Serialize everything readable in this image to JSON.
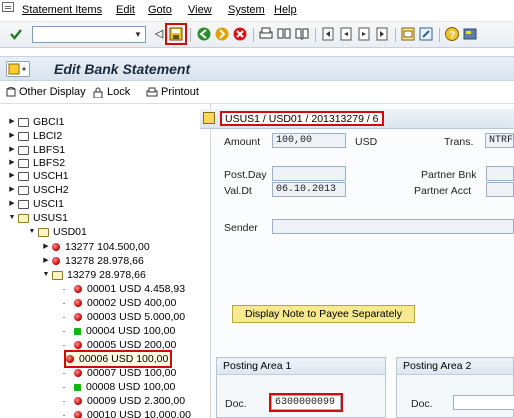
{
  "menubar": {
    "items": [
      "Statement Items",
      "Edit",
      "Goto",
      "View",
      "System",
      "Help"
    ]
  },
  "toolbar": {
    "command_field_value": "",
    "icons": [
      "check-icon",
      "back-icon",
      "save-icon",
      "nav-back-icon",
      "exit-icon",
      "cancel-icon",
      "print-icon",
      "find-icon",
      "find-next-icon",
      "first-page-icon",
      "prev-page-icon",
      "next-page-icon",
      "last-page-icon",
      "new-session-icon",
      "shortcut-icon",
      "help-icon",
      "customize-icon"
    ]
  },
  "title": "Edit Bank Statement",
  "app_toolbar": {
    "other_display": "Other Display",
    "lock": "Lock",
    "printout": "Printout"
  },
  "tree": {
    "nodes": [
      {
        "label": "GBCI1"
      },
      {
        "label": "LBCI2"
      },
      {
        "label": "LBFS1"
      },
      {
        "label": "LBFS2"
      },
      {
        "label": "USCH1"
      },
      {
        "label": "USCH2"
      },
      {
        "label": "USCI1"
      },
      {
        "label": "USUS1"
      },
      {
        "label": "USD01"
      },
      {
        "label": "13277  104.500,00"
      },
      {
        "label": "13278  28.978,66"
      },
      {
        "label": "13279  28.978,66"
      },
      {
        "label": "00001  USD 4.458,93"
      },
      {
        "label": "00002  USD 400,00"
      },
      {
        "label": "00003  USD 5.000,00"
      },
      {
        "label": "00004  USD 100,00"
      },
      {
        "label": "00005  USD 200,00"
      },
      {
        "label": "00006  USD 100,00"
      },
      {
        "label": "00007  USD 100,00"
      },
      {
        "label": "00008  USD 100,00"
      },
      {
        "label": "00009  USD 2.300,00"
      },
      {
        "label": "00010  USD 10.000,00"
      }
    ]
  },
  "statement": {
    "header": "USUS1 / USD01 / 201313279 / 6",
    "amount_label": "Amount",
    "amount_value": "100,00",
    "currency": "USD",
    "trans_label": "Trans.",
    "trans_value": "NTRF",
    "post_day_label": "Post.Day",
    "post_day_value": "",
    "val_dt_label": "Val.Dt",
    "val_dt_value": "06.10.2013",
    "partner_bnk_label": "Partner Bnk",
    "partner_bnk_value": "",
    "partner_acct_label": "Partner Acct",
    "partner_acct_value": "",
    "sender_label": "Sender",
    "sender_value": "",
    "note_button": "Display Note to Payee Separately"
  },
  "posting_area_1": {
    "title": "Posting Area 1",
    "doc_label": "Doc.",
    "doc_value": "6300000099"
  },
  "posting_area_2": {
    "title": "Posting Area 2",
    "doc_label": "Doc.",
    "doc_value": ""
  }
}
